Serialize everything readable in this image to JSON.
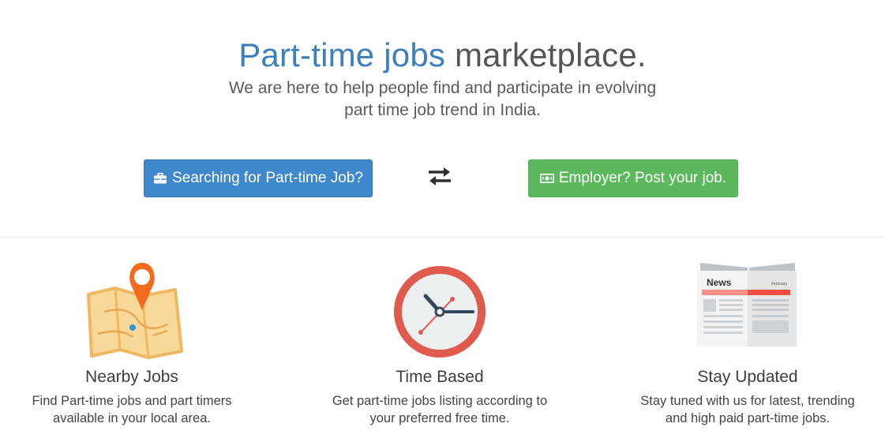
{
  "hero": {
    "title_accent": "Part-time jobs",
    "title_rest": " marketplace.",
    "subtitle_line1": "We are here to help people find and participate in evolving",
    "subtitle_line2": "part time job trend in India."
  },
  "actions": {
    "seeker_button": "Searching for Part-time Job?",
    "seeker_icon": "briefcase-icon",
    "swap_icon": "swap-arrows-icon",
    "employer_button": "Employer? Post your job.",
    "employer_icon": "money-icon",
    "seeker_color": "#3f88cb",
    "employer_color": "#5cb85c"
  },
  "features": [
    {
      "icon": "map-pin-icon",
      "title": "Nearby Jobs",
      "desc_line1": "Find Part-time jobs and part timers",
      "desc_line2": "available in your local area."
    },
    {
      "icon": "clock-icon",
      "title": "Time Based",
      "desc_line1": "Get part-time jobs listing according to",
      "desc_line2": "your preferred free time."
    },
    {
      "icon": "newspaper-icon",
      "title": "Stay Updated",
      "desc_line1": "Stay tuned with us for latest, trending",
      "desc_line2": "and high paid part-time jobs.",
      "newspaper_heading": "News",
      "newspaper_month": "February"
    }
  ]
}
